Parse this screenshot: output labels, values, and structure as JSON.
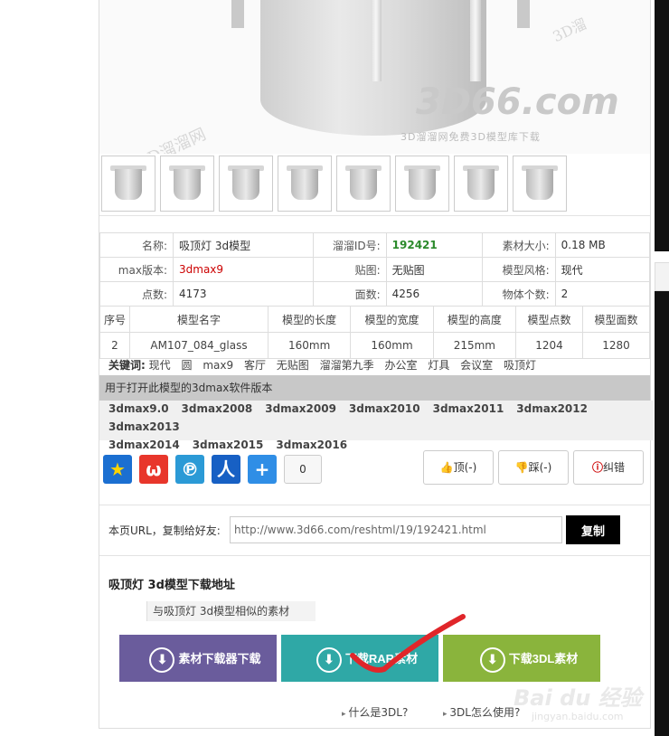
{
  "watermarks": {
    "hero_logo": "3D66.com",
    "hero_sub": "3D溜溜网免费3D模型库下载",
    "left": "3D溜溜网",
    "right": "3D溜",
    "baidu": "Bai du 经验",
    "baidu_url": "jingyan.baidu.com"
  },
  "thumbnails": 8,
  "info_table": {
    "name_label": "名称:",
    "name_value": "吸顶灯 3d模型",
    "id_label": "溜溜ID号:",
    "id_value": "192421",
    "size_label": "素材大小:",
    "size_value": "0.18 MB",
    "max_label": "max版本:",
    "max_value": "3dmax9",
    "map_label": "贴图:",
    "map_value": "无贴图",
    "style_label": "模型风格:",
    "style_value": "现代",
    "points_label": "点数:",
    "points_value": "4173",
    "faces_label": "面数:",
    "faces_value": "4256",
    "objects_label": "物体个数:",
    "objects_value": "2"
  },
  "spec_table": {
    "headers": [
      "序号",
      "模型名字",
      "模型的长度",
      "模型的宽度",
      "模型的高度",
      "模型点数",
      "模型面数"
    ],
    "row": [
      "2",
      "AM107_084_glass",
      "160mm",
      "160mm",
      "215mm",
      "1204",
      "1280"
    ]
  },
  "keywords": {
    "label": "关键词:",
    "items": [
      "现代",
      "圆",
      "max9",
      "客厅",
      "无贴图",
      "溜溜第九季",
      "办公室",
      "灯具",
      "会议室",
      "吸顶灯"
    ]
  },
  "versions": {
    "heading": "用于打开此模型的3dmax软件版本",
    "items": [
      "3dmax9.0",
      "3dmax2008",
      "3dmax2009",
      "3dmax2010",
      "3dmax2011",
      "3dmax2012",
      "3dmax2013",
      "3dmax2014",
      "3dmax2015",
      "3dmax2016"
    ]
  },
  "share": {
    "count": "0",
    "icons": [
      "qzone-icon",
      "weibo-icon",
      "tencent-weibo-icon",
      "renren-icon",
      "more-share-icon"
    ]
  },
  "votes": {
    "up": "顶(-)",
    "down": "踩(-)",
    "report": "纠错"
  },
  "url_copy": {
    "label": "本页URL，复制给好友:",
    "value": "http://www.3d66.com/reshtml/19/192421.html",
    "button": "复制"
  },
  "download": {
    "title": "吸顶灯 3d模型下载地址",
    "similar": "与吸顶灯 3d模型相似的素材",
    "btn_downloader": "素材下载器下载",
    "btn_rar": "下载RAR素材",
    "btn_3dl": "下载3DL素材",
    "help1": "什么是3DL?",
    "help2": "3DL怎么使用?"
  },
  "colors": {
    "btn_downloader": "#6a5c9c",
    "btn_rar": "#2fa8a6",
    "btn_3dl": "#8ab43c",
    "annotation": "#e0262a"
  }
}
